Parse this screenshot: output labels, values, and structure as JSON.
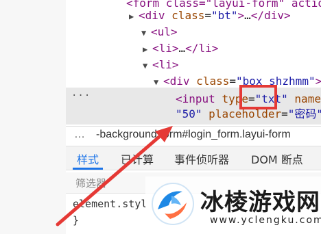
{
  "elements": {
    "lines": [
      {
        "indent": 0,
        "arrow": "",
        "parts": [
          {
            "t": "tag",
            "v": "<form class=\"layui-form\" action"
          }
        ]
      },
      {
        "indent": 1,
        "arrow": "▶",
        "parts": [
          {
            "t": "tag",
            "v": "<div "
          },
          {
            "t": "attr-name",
            "v": "class"
          },
          {
            "t": "txt",
            "v": "="
          },
          {
            "t": "attr-val",
            "v": "\"bt\""
          },
          {
            "t": "tag",
            "v": ">"
          },
          {
            "t": "txt",
            "v": "…"
          },
          {
            "t": "tag",
            "v": "</div>"
          }
        ]
      },
      {
        "indent": 1,
        "arrow": "▼",
        "parts": [
          {
            "t": "tag",
            "v": "<ul>"
          }
        ]
      },
      {
        "indent": 2,
        "arrow": "▶",
        "parts": [
          {
            "t": "tag",
            "v": "<li>"
          },
          {
            "t": "txt",
            "v": "…"
          },
          {
            "t": "tag",
            "v": "</li>"
          }
        ]
      },
      {
        "indent": 2,
        "arrow": "▼",
        "parts": [
          {
            "t": "tag",
            "v": "<li>"
          }
        ]
      },
      {
        "indent": 3,
        "arrow": "▼",
        "parts": [
          {
            "t": "tag",
            "v": "<div "
          },
          {
            "t": "attr-name",
            "v": "class"
          },
          {
            "t": "txt",
            "v": "="
          },
          {
            "t": "attr-val",
            "v": "\"box shzhmm\""
          },
          {
            "t": "tag",
            "v": ">"
          }
        ]
      },
      {
        "indent": 4,
        "arrow": "",
        "parts": [
          {
            "t": "tag",
            "v": "<input "
          },
          {
            "t": "attr-name",
            "v": "type"
          },
          {
            "t": "txt",
            "v": "="
          },
          {
            "t": "attr-val",
            "v": "\"txt\""
          },
          {
            "t": "txt",
            "v": " "
          },
          {
            "t": "attr-name",
            "v": "name"
          },
          {
            "t": "txt",
            "v": "="
          }
        ]
      },
      {
        "indent": 4,
        "arrow": "",
        "parts": [
          {
            "t": "attr-val",
            "v": "\"50\""
          },
          {
            "t": "txt",
            "v": " "
          },
          {
            "t": "attr-name",
            "v": "placeholder"
          },
          {
            "t": "txt",
            "v": "="
          },
          {
            "t": "attr-val",
            "v": "\"密码\""
          }
        ]
      }
    ],
    "selected_dots": "···"
  },
  "breadcrumb": {
    "dots": "…",
    "text": "-background   form#login_form.layui-form"
  },
  "tabs": [
    {
      "label": "样式",
      "active": true
    },
    {
      "label": "已计算",
      "active": false
    },
    {
      "label": "事件侦听器",
      "active": false
    },
    {
      "label": "DOM 断点",
      "active": false
    }
  ],
  "filter": {
    "placeholder": "筛选器"
  },
  "styles": {
    "line1": "element.styl",
    "line2": "}"
  },
  "watermark": {
    "title": "冰棱游戏网",
    "url": "www.yclengku.com"
  },
  "colors": {
    "highlight": "#e53935",
    "arrow": "#e53935",
    "active_tab": "#1a73e8"
  }
}
